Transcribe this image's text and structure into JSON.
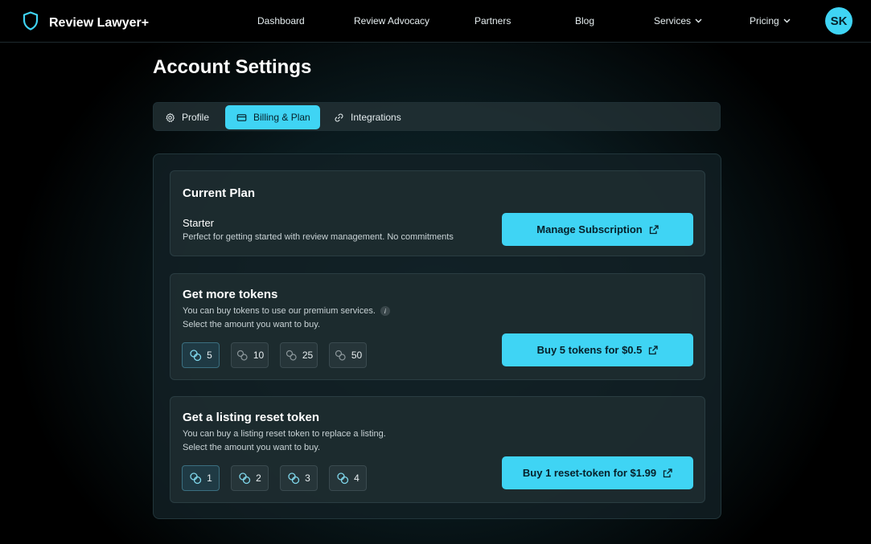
{
  "header": {
    "brand_name": "Review Lawyer+",
    "brand_icon": "shield-icon",
    "nav": [
      {
        "label": "Dashboard"
      },
      {
        "label": "Review Advocacy"
      },
      {
        "label": "Partners"
      },
      {
        "label": "Blog"
      },
      {
        "label": "Services",
        "icon": "chevron-down-icon"
      },
      {
        "label": "Pricing",
        "icon": "chevron-down-icon"
      }
    ],
    "avatar_initials": "SK"
  },
  "page": {
    "title": "Account Settings",
    "tabs": [
      {
        "label": "Profile",
        "icon": "gear-icon",
        "active": false
      },
      {
        "label": "Billing & Plan",
        "icon": "credit-card-icon",
        "active": true
      },
      {
        "label": "Integrations",
        "icon": "link-icon",
        "active": false
      }
    ]
  },
  "current_plan": {
    "heading": "Current Plan",
    "plan_name": "Starter",
    "description": "Perfect for getting started with review management. No commitments",
    "button_label": "Manage Subscription",
    "button_icon": "external-link-icon"
  },
  "tokens": {
    "heading": "Get more tokens",
    "line1": "You can buy tokens to use our premium services.",
    "info_glyph": "i",
    "line2": "Select the amount you want to buy.",
    "options": [
      "5",
      "10",
      "25",
      "50"
    ],
    "selected": "5",
    "option_icon": "coins-icon",
    "button_label": "Buy 5 tokens for $0.5",
    "button_icon": "external-link-icon"
  },
  "reset": {
    "heading": "Get a listing reset token",
    "line1": "You can buy a listing reset token to replace a listing.",
    "line2": "Select the amount you want to buy.",
    "options": [
      "1",
      "2",
      "3",
      "4"
    ],
    "selected": "1",
    "option_icon": "coins-icon",
    "button_label": "Buy 1 reset-token for $1.99",
    "button_icon": "external-link-icon"
  },
  "colors": {
    "accent": "#3fd4f4",
    "background": "#000000",
    "card": "#1e2c30"
  }
}
